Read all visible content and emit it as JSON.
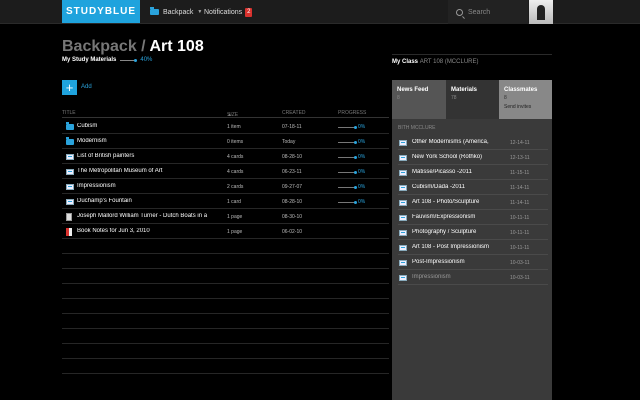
{
  "topbar": {
    "logo": "STUDYBLUE",
    "backpack_label": "Backpack",
    "notifications_label": "Notifications",
    "notifications_count": "2",
    "search_placeholder": "Search"
  },
  "page": {
    "title_prefix": "Backpack /",
    "title": "Art 108",
    "subtitle": "My Study Materials",
    "subtitle_progress": "40%",
    "add_label": "Add"
  },
  "table": {
    "headers": {
      "title": "TITLE",
      "size": "SIZE",
      "sort_arrow": "▲",
      "created": "CREATED",
      "progress": "PROGRESS"
    },
    "rows": [
      {
        "icon": "folder",
        "name": "Cubism",
        "size": "1 item",
        "created": "07-18-11",
        "progress": "0%"
      },
      {
        "icon": "folder",
        "name": "Modernism",
        "size": "0 items",
        "created": "Today",
        "progress": "0%"
      },
      {
        "icon": "card",
        "name": "List of British painters",
        "size": "4 cards",
        "created": "08-28-10",
        "progress": "0%"
      },
      {
        "icon": "card",
        "name": "The Metropolitan Museum of Art",
        "size": "4 cards",
        "created": "06-23-11",
        "progress": "0%"
      },
      {
        "icon": "card",
        "name": "Impressionism",
        "size": "2 cards",
        "created": "09-27-07",
        "progress": "0%"
      },
      {
        "icon": "card",
        "name": "Duchamp's Fountain",
        "size": "1 card",
        "created": "08-28-10",
        "progress": "0%"
      },
      {
        "icon": "doc",
        "name": "Joseph Mallord William Turner - Dutch Boats in a",
        "size": "1 page",
        "created": "08-30-10",
        "progress": ""
      },
      {
        "icon": "pdf",
        "name": "Book Notes for Jun 3, 2010",
        "size": "1 page",
        "created": "06-02-10",
        "progress": ""
      }
    ]
  },
  "class_panel": {
    "label": "My Class",
    "class_name": "ART 108 (MCCLURE)",
    "tabs": [
      {
        "label": "News Feed",
        "sub": "8"
      },
      {
        "label": "Materials",
        "sub": "78"
      },
      {
        "label": "Classmates",
        "sub": "8",
        "action": "Send invites"
      }
    ],
    "teacher": "BITH MCCLURE",
    "items": [
      {
        "name": "Other Modernisms (America,",
        "date": "12-14-11"
      },
      {
        "name": "New York School (Rothko)",
        "date": "12-13-11"
      },
      {
        "name": "Matisse/Picasso -2011",
        "date": "11-15-11"
      },
      {
        "name": "Cubism/Dada -2011",
        "date": "11-14-11"
      },
      {
        "name": "Art 108 - Photo/Sculpture",
        "date": "11-14-11"
      },
      {
        "name": "Fauvism/Expressionism",
        "date": "10-11-11"
      },
      {
        "name": "Photography / Sculpture",
        "date": "10-11-11"
      },
      {
        "name": "Art 108 - Post Impressionism",
        "date": "10-11-11"
      },
      {
        "name": "Post-Impressionism",
        "date": "10-03-11"
      },
      {
        "name": "Impressionism",
        "date": "10-03-11"
      }
    ]
  },
  "colors": {
    "accent": "#1fa3dd",
    "badge": "#d9322e"
  }
}
